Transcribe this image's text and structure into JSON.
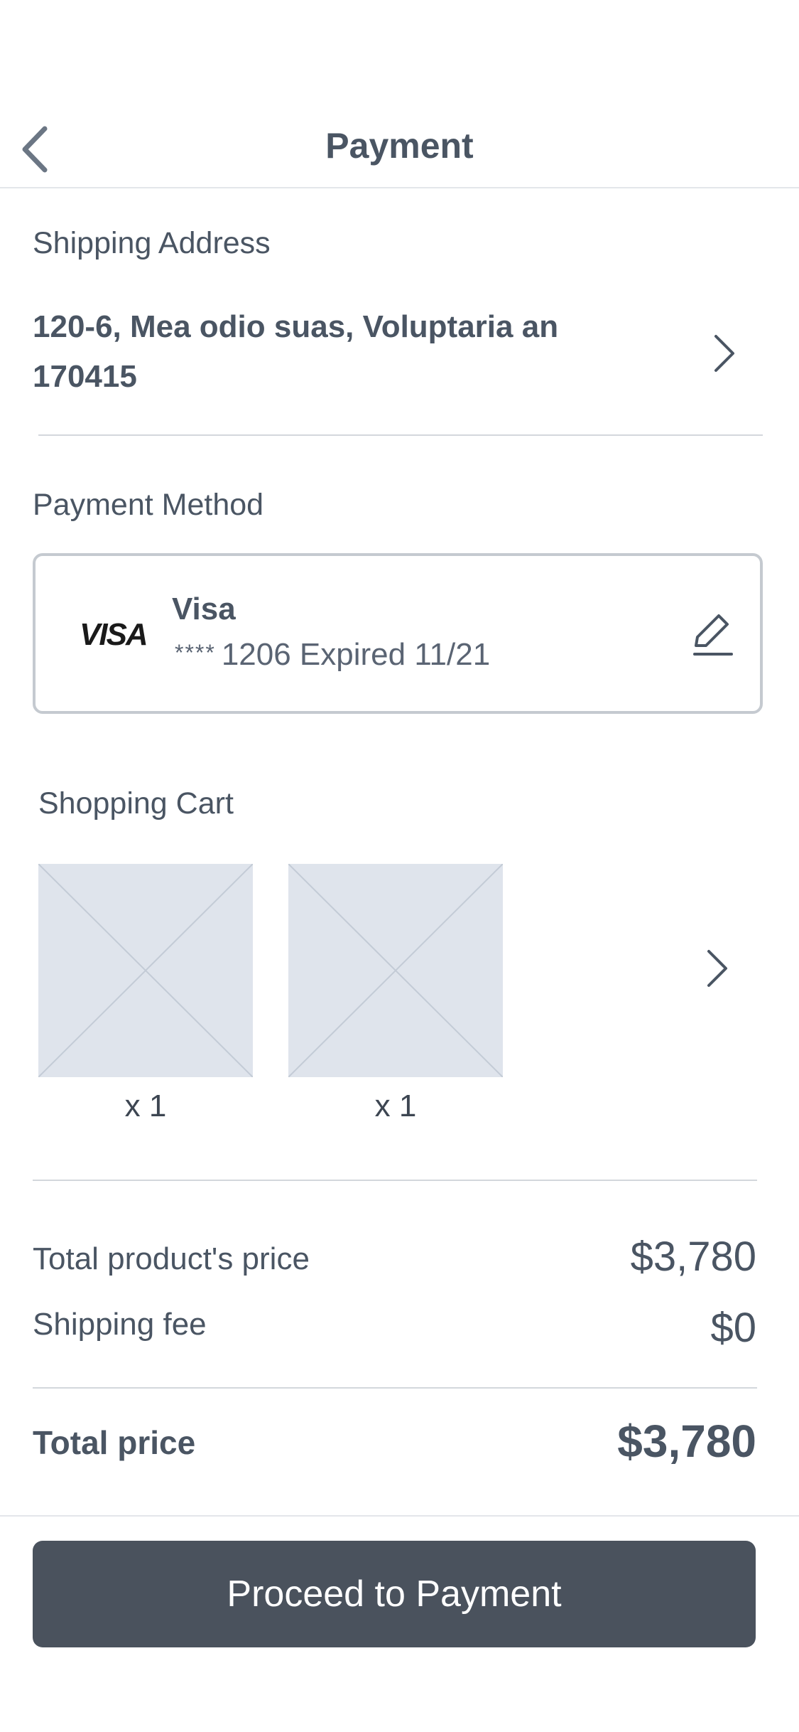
{
  "header": {
    "title": "Payment",
    "back_icon": "chevron-left-icon"
  },
  "shipping": {
    "label": "Shipping Address",
    "address_line1": "120-6, Mea odio suas, Voluptaria an",
    "address_line2": "170415",
    "chevron_icon": "chevron-right-icon"
  },
  "payment_method": {
    "label": "Payment Method",
    "card": {
      "logo_text": "VISA",
      "name": "Visa",
      "masked_number": "****",
      "detail": "1206 Expired 11/21",
      "edit_icon": "pencil-icon"
    }
  },
  "cart": {
    "label": "Shopping Cart",
    "items": [
      {
        "quantity": "x 1",
        "image": "image-placeholder-icon"
      },
      {
        "quantity": "x 1",
        "image": "image-placeholder-icon"
      }
    ],
    "chevron_icon": "chevron-right-icon"
  },
  "summary": {
    "product_price_label": "Total product's price",
    "product_price_value": "$3,780",
    "shipping_fee_label": "Shipping fee",
    "shipping_fee_value": "$0",
    "total_label": "Total price",
    "total_value": "$3,780"
  },
  "footer": {
    "proceed_label": "Proceed to Payment"
  },
  "colors": {
    "text": "#4a5563",
    "button_bg": "#4a525d",
    "border": "#c5cad0",
    "placeholder_bg": "#dfe4ec"
  }
}
